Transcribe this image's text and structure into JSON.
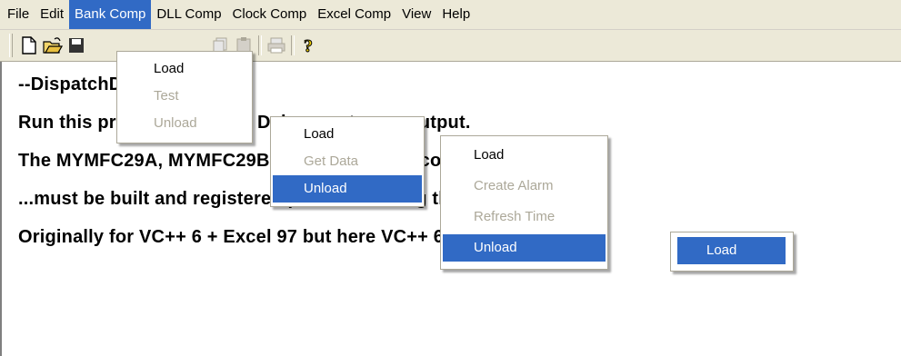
{
  "menubar": {
    "items": [
      "File",
      "Edit",
      "Bank Comp",
      "DLL Comp",
      "Clock Comp",
      "Excel Comp",
      "View",
      "Help"
    ]
  },
  "content": {
    "lines": [
      "--DispatchDriver usage--",
      "Run this program from the Debugger to see output.",
      "The MYMFC29A, MYMFC29B and MYMFC29C components...",
      "...must be built and registered prior to running this program",
      "Originally for VC++ 6 + Excel 97 but here VC++ 6 + Excel 2003..."
    ]
  },
  "menus": {
    "bank": {
      "items": [
        "Load",
        "Test",
        "Unload"
      ]
    },
    "dll": {
      "items": [
        "Load",
        "Get Data",
        "Unload"
      ]
    },
    "clock": {
      "items": [
        "Load",
        "Create Alarm",
        "Refresh Time",
        "Unload"
      ]
    },
    "excel": {
      "items": [
        "Load"
      ]
    }
  },
  "colors": {
    "highlight": "#316ac5",
    "menubar_bg": "#ece9d8",
    "disabled_text": "#aca899"
  },
  "icons": [
    "new-file-icon",
    "open-folder-icon",
    "save-icon",
    "cut-icon",
    "copy-icon",
    "paste-icon",
    "print-icon",
    "help-icon"
  ]
}
